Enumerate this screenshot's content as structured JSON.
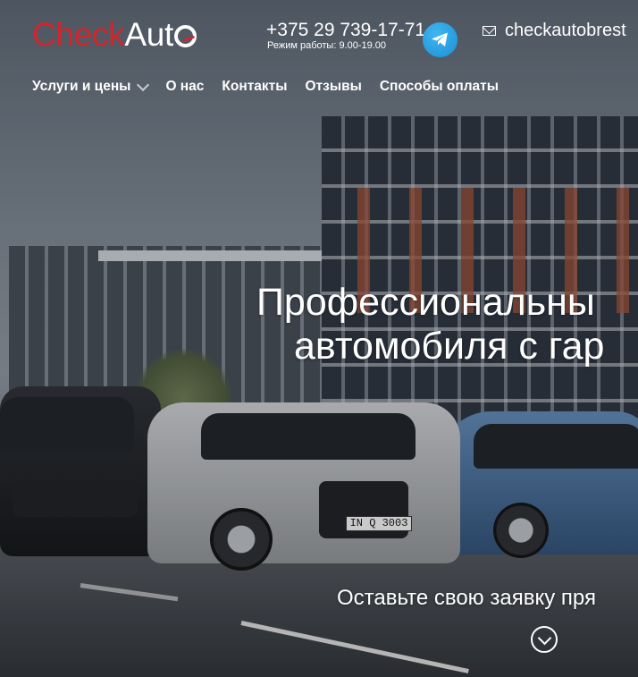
{
  "logo": {
    "check": "Check",
    "auto": "Aut"
  },
  "contact": {
    "phone": "+375 29 739-17-71",
    "hours": "Режим работы: 9.00-19.00",
    "email": "checkautobrest"
  },
  "nav": {
    "items": [
      {
        "label": "Услуги и цены"
      },
      {
        "label": "О нас"
      },
      {
        "label": "Контакты"
      },
      {
        "label": "Отзывы"
      },
      {
        "label": "Способы оплаты"
      }
    ]
  },
  "hero": {
    "headline_line1": "Профессиональны",
    "headline_line2": "автомобиля с гар",
    "subline": "Оставьте свою заявку пря",
    "plate": "IN Q 3003"
  },
  "colors": {
    "brand_red": "#d0262d",
    "telegram_blue": "#2aa3e3"
  },
  "icons": [
    "telegram-icon",
    "mail-icon",
    "chevron-down-icon",
    "scroll-down-icon"
  ]
}
